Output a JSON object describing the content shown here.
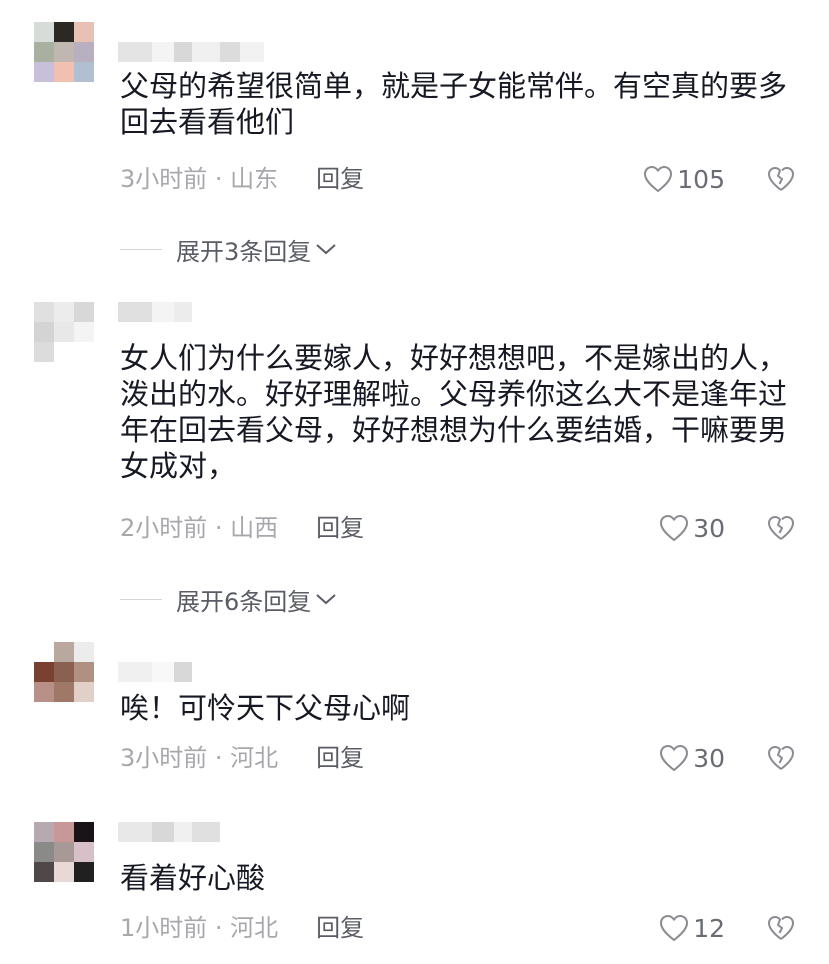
{
  "comments": [
    {
      "text": "父母的希望很简单，就是子女能常伴。有空真的要多回去看看他们",
      "time_location": "3小时前 · 山东",
      "reply_label": "回复",
      "likes": "105",
      "expand_label": "展开3条回复",
      "avatar_colors": [
        "#d8dcd8",
        "#2c2824",
        "#e8c0b4",
        "#a8b0a0",
        "#c0b8b0",
        "#b8b0c0",
        "#c8c0d8",
        "#f0c0b0",
        "#b0c0d0"
      ],
      "name_colors": [
        "#e4e4e4",
        "#f4f4f4",
        "#d8d8d8",
        "#f0f0f0",
        "#dcdcdc",
        "#f2f2f2"
      ]
    },
    {
      "text": "女人们为什么要嫁人，好好想想吧，不是嫁出的人，泼出的水。好好理解啦。父母养你这么大不是逢年过年在回去看父母，好好想想为什么要结婚，干嘛要男女成对，",
      "time_location": "2小时前 · 山西",
      "reply_label": "回复",
      "likes": "30",
      "expand_label": "展开6条回复",
      "avatar_colors": [
        "#e0e0e0",
        "#ececec",
        "#d8d8d8",
        "#d4d4d4",
        "#e8e8e8",
        "#f4f4f4",
        "#dcdcdc",
        "#ffffff",
        "#ffffff"
      ],
      "name_colors": [
        "#e0e0e0",
        "#f4f4f4",
        "#ececec"
      ]
    },
    {
      "text": "唉！可怜天下父母心啊",
      "time_location": "3小时前 · 河北",
      "reply_label": "回复",
      "likes": "30",
      "avatar_colors": [
        "#ffffff",
        "#b8a8a0",
        "#ececec",
        "#7a4030",
        "#8a6050",
        "#b09080",
        "#b89088",
        "#a07868",
        "#e0d0c8"
      ],
      "name_colors": [
        "#f0f0f0",
        "#f8f8f8",
        "#d8d8d8"
      ]
    },
    {
      "text": "看着好心酸",
      "time_location": "1小时前 · 河北",
      "reply_label": "回复",
      "likes": "12",
      "avatar_colors": [
        "#b8a8b0",
        "#c89898",
        "#181418",
        "#8a8a88",
        "#a89898",
        "#d8c0c8",
        "#504848",
        "#e8d8d8",
        "#202020"
      ],
      "name_colors": [
        "#e8e8e8",
        "#d8d8d8",
        "#f0f0f0",
        "#e0e0e0"
      ]
    }
  ]
}
